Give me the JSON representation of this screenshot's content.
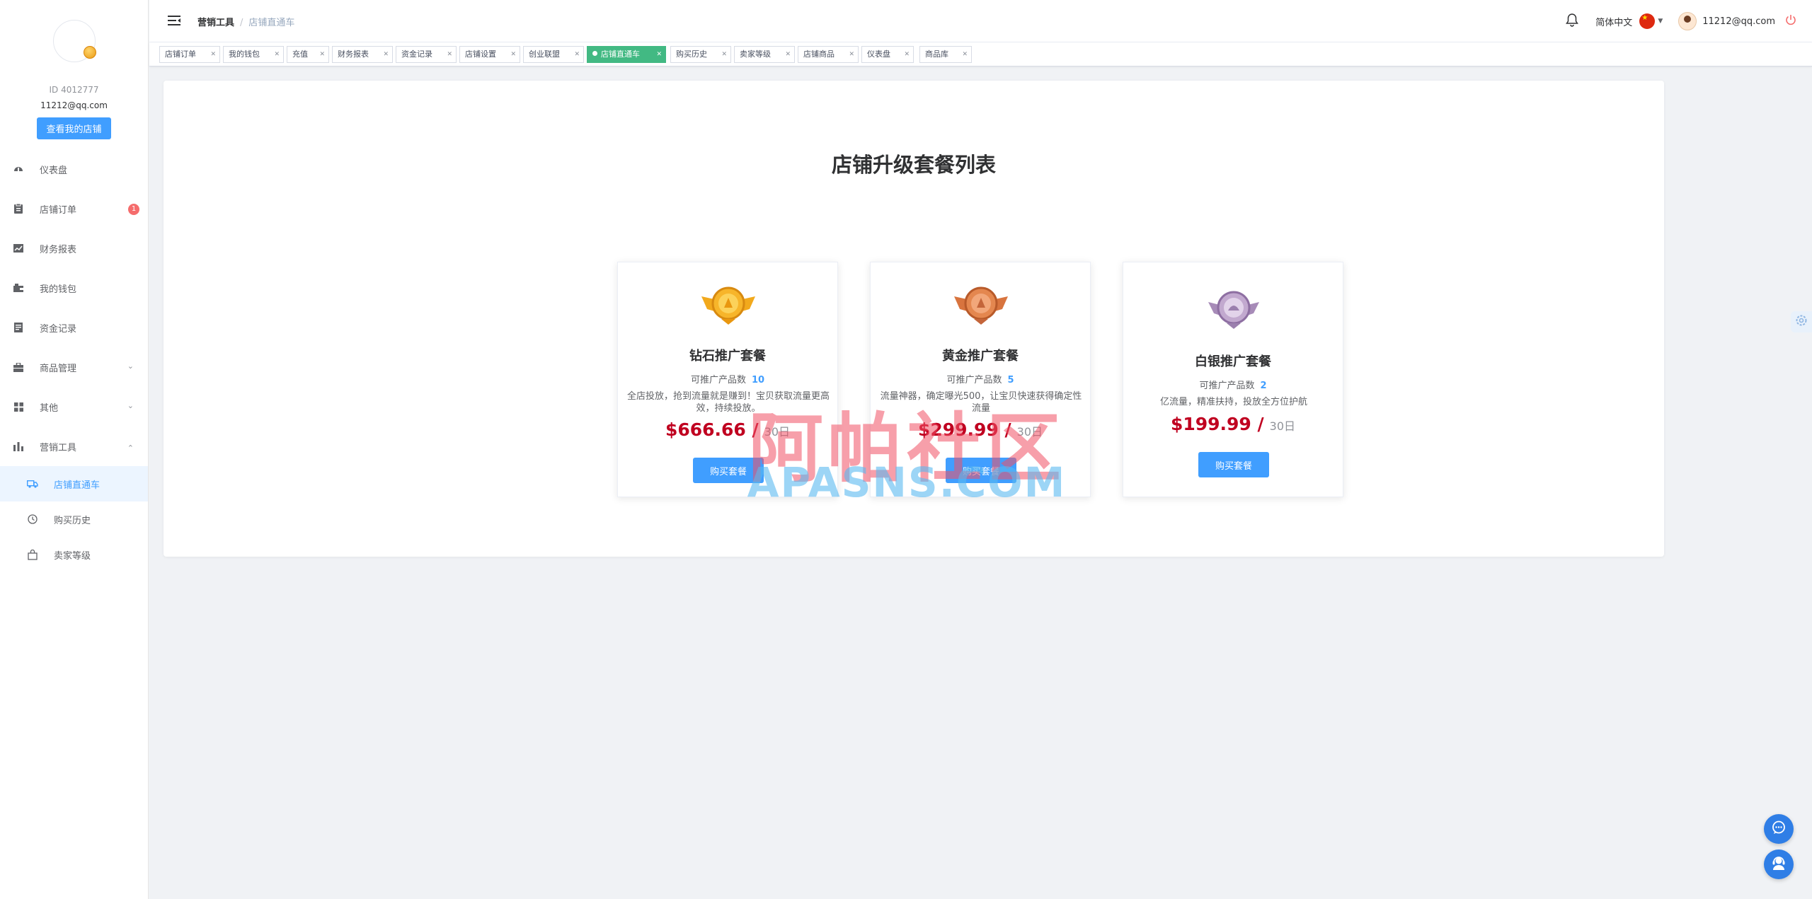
{
  "profile": {
    "user_id": "ID 4012777",
    "email": "11212@qq.com",
    "view_shop_label": "查看我的店铺"
  },
  "sidebar": {
    "items": [
      {
        "label": "仪表盘",
        "icon": "dashboard-icon"
      },
      {
        "label": "店铺订单",
        "icon": "clipboard-icon",
        "badge": "1"
      },
      {
        "label": "财务报表",
        "icon": "chart-line-icon"
      },
      {
        "label": "我的钱包",
        "icon": "wallet-icon"
      },
      {
        "label": "资金记录",
        "icon": "document-icon"
      },
      {
        "label": "商品管理",
        "icon": "briefcase-icon"
      },
      {
        "label": "其他",
        "icon": "grid-icon"
      },
      {
        "label": "营销工具",
        "icon": "bar-chart-icon"
      }
    ],
    "submenu": [
      {
        "label": "店铺直通车",
        "icon": "truck-icon"
      },
      {
        "label": "购买历史",
        "icon": "clock-icon"
      },
      {
        "label": "卖家等级",
        "icon": "shopping-bag-icon"
      }
    ]
  },
  "header": {
    "breadcrumb_parent": "营销工具",
    "breadcrumb_current": "店铺直通车",
    "language": "简体中文",
    "username": "11212@qq.com"
  },
  "tags": [
    "店铺订单",
    "我的钱包",
    "充值",
    "财务报表",
    "资金记录",
    "店铺设置",
    "创业联盟",
    "店铺直通车",
    "购买历史",
    "卖家等级",
    "店铺商品",
    "仪表盘",
    "商品库"
  ],
  "main": {
    "title": "店铺升级套餐列表",
    "count_label": "可推广产品数",
    "buy_label": "购买套餐",
    "plans": [
      {
        "name": "钻石推广套餐",
        "count": "10",
        "desc": "全店投放，抢到流量就是赚到！宝贝获取流量更高效，持续投放。",
        "price": "$666.66 /",
        "period": "30日"
      },
      {
        "name": "黄金推广套餐",
        "count": "5",
        "desc": "流量神器，确定曝光500，让宝贝快速获得确定性流量",
        "price": "$299.99 /",
        "period": "30日"
      },
      {
        "name": "白银推广套餐",
        "count": "2",
        "desc": "亿流量，精准扶持，投放全方位护航",
        "price": "$199.99 /",
        "period": "30日"
      }
    ]
  },
  "watermark": {
    "cn": "阿帕社区",
    "en": "APASNS.COM"
  },
  "colors": {
    "primary": "#409eff",
    "active_tag": "#42b983",
    "price": "#c00020",
    "badge": "#f56c6c"
  }
}
